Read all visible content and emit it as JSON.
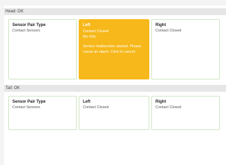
{
  "head": {
    "status": "Head: OK",
    "sensor_pair": {
      "title": "Sensor Pair Type",
      "value": "Contact Sensors"
    },
    "left": {
      "title": "Left",
      "status": "Contact Closed",
      "duration": "0hr-50s",
      "message": "Sensor malfunction started. Please cause an alarm. Click to cancel.",
      "accent_color": "#f6b81a"
    },
    "right": {
      "title": "Right",
      "status": "Contact Closed"
    }
  },
  "tail": {
    "status": "Tail: OK",
    "sensor_pair": {
      "title": "Sensor Pair Type",
      "value": "Contact Sensors"
    },
    "left": {
      "title": "Left",
      "status": "Contact Closed"
    },
    "right": {
      "title": "Right",
      "status": "Contact Closed"
    }
  }
}
